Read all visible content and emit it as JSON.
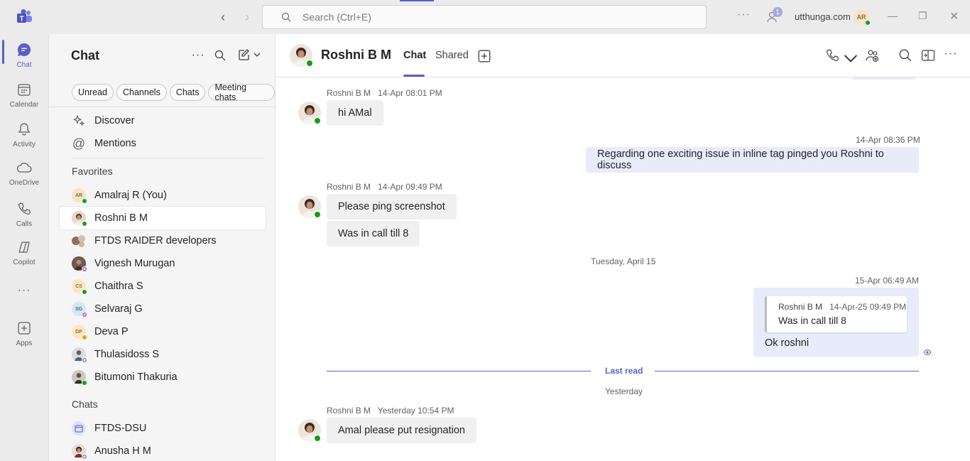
{
  "titlebar": {
    "search_placeholder": "Search (Ctrl+E)",
    "notification_count": "1",
    "org_name": "utthunga.com",
    "user_initials": "AR"
  },
  "rail": {
    "items": [
      {
        "label": "Chat",
        "icon": "chat-icon"
      },
      {
        "label": "Calendar",
        "icon": "calendar-icon"
      },
      {
        "label": "Activity",
        "icon": "bell-icon"
      },
      {
        "label": "OneDrive",
        "icon": "cloud-icon"
      },
      {
        "label": "Calls",
        "icon": "phone-icon"
      },
      {
        "label": "Copilot",
        "icon": "copilot-icon"
      },
      {
        "label": "Apps",
        "icon": "add-app-icon"
      }
    ]
  },
  "list": {
    "title": "Chat",
    "filters": [
      "Unread",
      "Channels",
      "Chats",
      "Meeting chats"
    ],
    "nav": [
      {
        "label": "Discover",
        "icon": "sparkle-icon"
      },
      {
        "label": "Mentions",
        "icon": "at-icon"
      }
    ],
    "favorites_label": "Favorites",
    "favorites": [
      {
        "name": "Amalraj R (You)",
        "initials": "AR"
      },
      {
        "name": "Roshni B M",
        "initials": ""
      },
      {
        "name": "FTDS RAIDER developers",
        "initials": ""
      },
      {
        "name": "Vignesh Murugan",
        "initials": ""
      },
      {
        "name": "Chaithra S",
        "initials": "CS"
      },
      {
        "name": "Selvaraj G",
        "initials": "SG"
      },
      {
        "name": "Deva P",
        "initials": "DP"
      },
      {
        "name": "Thulasidoss S",
        "initials": ""
      },
      {
        "name": "Bitumoni Thakuria",
        "initials": ""
      }
    ],
    "chats_label": "Chats",
    "chats": [
      {
        "name": "FTDS-DSU",
        "initials": ""
      },
      {
        "name": "Anusha H M",
        "initials": ""
      }
    ]
  },
  "header": {
    "name": "Roshni B M",
    "tabs": [
      "Chat",
      "Shared"
    ]
  },
  "messages": {
    "m1": {
      "sender": "Roshni B M",
      "time": "14-Apr 08:01 PM",
      "text": "hi AMal"
    },
    "m2": {
      "time": "14-Apr 08:36 PM",
      "text": "Regarding one exciting issue in inline tag pinged you Roshni to discuss"
    },
    "m3": {
      "sender": "Roshni B M",
      "time": "14-Apr 09:49 PM",
      "text1": "Please ping screenshot",
      "text2": "Was in call till 8"
    },
    "date1": "Tuesday, April 15",
    "m4": {
      "time": "15-Apr 06:49 AM",
      "quote_sender": "Roshni B M",
      "quote_time": "14-Apr-25 09:49 PM",
      "quote_text": "Was in call till 8",
      "text": "Ok roshni"
    },
    "last_read": "Last read",
    "date2": "Yesterday",
    "m5": {
      "sender": "Roshni B M",
      "time": "Yesterday 10:54 PM",
      "text": "Amal please put resignation"
    }
  }
}
